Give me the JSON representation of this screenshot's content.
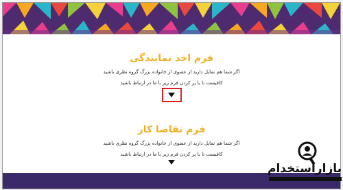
{
  "colors": {
    "title": "#f0b020",
    "banner_bg": "#4e2a6e",
    "highlight": "#e02020"
  },
  "form_sections": [
    {
      "title": "فرم اخذ نمایندگی",
      "line1": "اگر شما هم تمایل دارید از عضوی از خانواده بزرگ گروه نظری باشید",
      "line2": "کافیست تا با پر کردن فرم زیر با ما در ارتباط باشید",
      "toggle_icon": "triangle-down"
    },
    {
      "title": "فرم تقاضا کار",
      "line1": "اگر شما هم تمایل دارید از عضوی از خانواده بزرگ گروه نظری باشید",
      "line2": "کافیست تا با پر کردن فرم زیر با ما در ارتباط باشید",
      "toggle_icon": "triangle-down"
    }
  ],
  "watermark": {
    "text": "بازاراستخدام",
    "icon": "person-search-icon"
  }
}
